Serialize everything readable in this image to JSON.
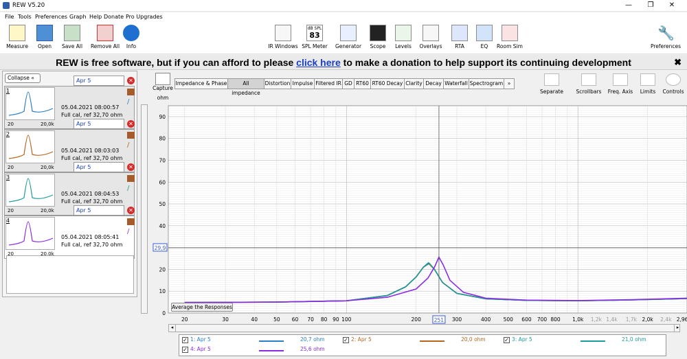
{
  "window": {
    "title": "REW V5.20",
    "controls": [
      "—",
      "❐",
      "✕"
    ]
  },
  "menu": [
    "File",
    "Tools",
    "Preferences",
    "Graph",
    "Help",
    "Donate",
    "Pro Upgrades"
  ],
  "toolbar": {
    "left": [
      "Measure",
      "Open",
      "Save All",
      "Remove All",
      "Info"
    ],
    "center": [
      "IR Windows",
      "SPL Meter",
      "Generator",
      "Scope",
      "Levels",
      "Overlays",
      "RTA",
      "EQ",
      "Room Sim"
    ],
    "spl_label": "dB SPL",
    "spl_value": "83",
    "right": "Preferences"
  },
  "banner": {
    "before": "REW is free software, but if you can afford to please ",
    "link": "click here",
    "after": " to make a donation to help support its continuing development",
    "close": "✖"
  },
  "panel": {
    "collapse": "Collapse",
    "measurements": [
      {
        "num": "1",
        "name": "Apr 5",
        "datetime": "05.04.2021 08:00:57",
        "cal": "Full cal, ref 32,70 ohm",
        "xmin": "20",
        "xmax": "20,0k",
        "color": "#2a7fc4"
      },
      {
        "num": "2",
        "name": "Apr 5",
        "datetime": "05.04.2021 08:03:03",
        "cal": "Full cal, ref 32,70 ohm",
        "xmin": "20",
        "xmax": "20,0k",
        "color": "#b5651d"
      },
      {
        "num": "3",
        "name": "Apr 5",
        "datetime": "05.04.2021 08:04:53",
        "cal": "Full cal, ref 32,70 ohm",
        "xmin": "20",
        "xmax": "20,0k",
        "color": "#1d9a9a"
      },
      {
        "num": "4",
        "name": "Apr 5",
        "datetime": "05.04.2021 08:05:41",
        "cal": "Full cal, ref 32,70 ohm",
        "xmin": "20",
        "xmax": "20,0k",
        "color": "#8a2be2"
      }
    ]
  },
  "capture": {
    "label": "Capture",
    "unit": "ohm"
  },
  "tabs": [
    "Impedance & Phase",
    "All impedance",
    "Distortion",
    "Impulse",
    "Filtered IR",
    "GD",
    "RT60",
    "RT60 Decay",
    "Clarity",
    "Decay",
    "Waterfall",
    "Spectrogram",
    "»"
  ],
  "active_tab": "All impedance",
  "graph_tools": [
    "Separate",
    "Scrollbars",
    "Freq. Axis",
    "Limits",
    "Controls"
  ],
  "average_button": "Average the Responses",
  "cursor": {
    "y_label": "29,9",
    "x_label": "251"
  },
  "chart_data": {
    "type": "line",
    "ylabel": "ohm",
    "ylim": [
      0,
      95
    ],
    "y_ticks": [
      "90",
      "80",
      "70",
      "60",
      "50",
      "40",
      "30",
      "20",
      "10",
      "0"
    ],
    "xlim": [
      17,
      2960
    ],
    "x_scale": "log",
    "x_ticks": [
      {
        "v": 20,
        "t": "20"
      },
      {
        "v": 30,
        "t": "30"
      },
      {
        "v": 40,
        "t": "40"
      },
      {
        "v": 50,
        "t": "50"
      },
      {
        "v": 60,
        "t": "60"
      },
      {
        "v": 70,
        "t": "70"
      },
      {
        "v": 80,
        "t": "80"
      },
      {
        "v": 90,
        "t": "90"
      },
      {
        "v": 100,
        "t": "100"
      },
      {
        "v": 200,
        "t": "200"
      },
      {
        "v": 300,
        "t": "300"
      },
      {
        "v": 400,
        "t": "400"
      },
      {
        "v": 500,
        "t": "500"
      },
      {
        "v": 600,
        "t": "600"
      },
      {
        "v": 700,
        "t": "700"
      },
      {
        "v": 800,
        "t": "800"
      },
      {
        "v": 1000,
        "t": "1,0k"
      },
      {
        "v": 1200,
        "t": "1,2k"
      },
      {
        "v": 1400,
        "t": "1,4k"
      },
      {
        "v": 1700,
        "t": "1,7k"
      },
      {
        "v": 2000,
        "t": "2,0k"
      },
      {
        "v": 2400,
        "t": "2,4k"
      },
      {
        "v": 2960,
        "t": "2,96kHz"
      }
    ],
    "series": [
      {
        "name": "1: Apr 5",
        "color": "#2a7fc4",
        "points": [
          [
            20,
            4.8
          ],
          [
            50,
            5.0
          ],
          [
            100,
            5.6
          ],
          [
            150,
            8.0
          ],
          [
            180,
            12.0
          ],
          [
            200,
            16.5
          ],
          [
            215,
            21.0
          ],
          [
            226,
            23.0
          ],
          [
            240,
            20.0
          ],
          [
            260,
            14.0
          ],
          [
            300,
            9.0
          ],
          [
            400,
            6.5
          ],
          [
            600,
            5.8
          ],
          [
            1000,
            5.6
          ],
          [
            1700,
            6.0
          ],
          [
            2960,
            6.6
          ]
        ]
      },
      {
        "name": "2: Apr 5",
        "color": "#b5651d",
        "points": [
          [
            20,
            4.8
          ],
          [
            50,
            5.0
          ],
          [
            100,
            5.6
          ],
          [
            150,
            8.0
          ],
          [
            180,
            12.0
          ],
          [
            200,
            16.5
          ],
          [
            215,
            21.0
          ],
          [
            227,
            22.6
          ],
          [
            240,
            20.0
          ],
          [
            260,
            14.0
          ],
          [
            300,
            9.0
          ],
          [
            400,
            6.5
          ],
          [
            600,
            5.8
          ],
          [
            1000,
            5.6
          ],
          [
            1700,
            6.0
          ],
          [
            2960,
            6.6
          ]
        ]
      },
      {
        "name": "3: Apr 5",
        "color": "#1d9a9a",
        "points": [
          [
            20,
            4.8
          ],
          [
            50,
            5.0
          ],
          [
            100,
            5.6
          ],
          [
            150,
            8.0
          ],
          [
            180,
            12.0
          ],
          [
            200,
            16.5
          ],
          [
            215,
            21.0
          ],
          [
            228,
            22.8
          ],
          [
            240,
            20.0
          ],
          [
            260,
            14.0
          ],
          [
            300,
            9.0
          ],
          [
            400,
            6.5
          ],
          [
            600,
            5.8
          ],
          [
            1000,
            5.6
          ],
          [
            1700,
            6.0
          ],
          [
            2960,
            6.6
          ]
        ]
      },
      {
        "name": "4: Apr 5",
        "color": "#8a2be2",
        "points": [
          [
            20,
            4.8
          ],
          [
            50,
            5.0
          ],
          [
            100,
            5.6
          ],
          [
            150,
            7.2
          ],
          [
            200,
            11.0
          ],
          [
            225,
            16.0
          ],
          [
            240,
            21.0
          ],
          [
            251,
            25.6
          ],
          [
            262,
            22.0
          ],
          [
            280,
            15.0
          ],
          [
            320,
            9.5
          ],
          [
            400,
            6.8
          ],
          [
            600,
            5.9
          ],
          [
            1000,
            5.7
          ],
          [
            1700,
            6.1
          ],
          [
            2960,
            6.8
          ]
        ]
      }
    ]
  },
  "legend": [
    {
      "label": "1: Apr 5",
      "value": "20,7 ohm",
      "color": "#2a7fc4"
    },
    {
      "label": "2: Apr 5",
      "value": "20,0 ohm",
      "color": "#b5651d"
    },
    {
      "label": "3: Apr 5",
      "value": "21,0 ohm",
      "color": "#1d9a9a"
    },
    {
      "label": "4: Apr 5",
      "value": "25,6 ohm",
      "color": "#8a2be2"
    }
  ]
}
